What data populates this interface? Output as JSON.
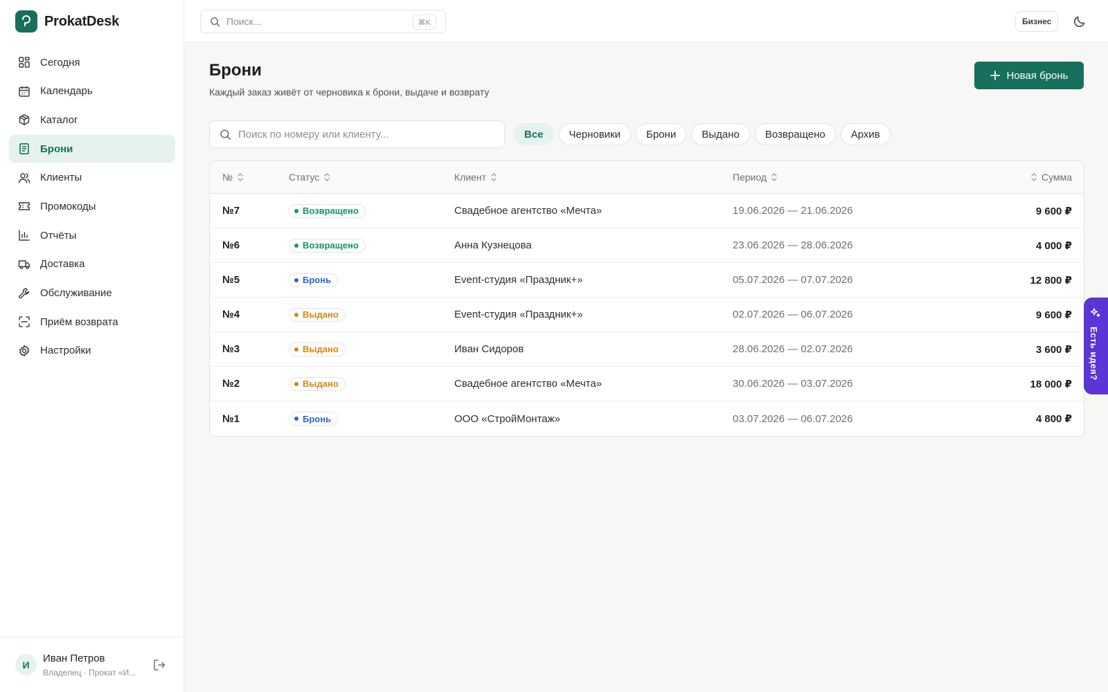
{
  "app": {
    "name": "ProkatDesk"
  },
  "sidebar": {
    "items": [
      {
        "label": "Сегодня",
        "icon": "dashboard-icon"
      },
      {
        "label": "Календарь",
        "icon": "calendar-icon"
      },
      {
        "label": "Каталог",
        "icon": "package-icon"
      },
      {
        "label": "Брони",
        "icon": "document-icon",
        "active": true
      },
      {
        "label": "Клиенты",
        "icon": "users-icon"
      },
      {
        "label": "Промокоды",
        "icon": "ticket-icon"
      },
      {
        "label": "Отчёты",
        "icon": "chart-icon"
      },
      {
        "label": "Доставка",
        "icon": "truck-icon"
      },
      {
        "label": "Обслуживание",
        "icon": "wrench-icon"
      },
      {
        "label": "Приём возврата",
        "icon": "scan-icon"
      },
      {
        "label": "Настройки",
        "icon": "gear-icon"
      }
    ]
  },
  "user": {
    "initial": "И",
    "name": "Иван Петров",
    "role": "Владелец · Прокат «И..."
  },
  "topbar": {
    "search_placeholder": "Поиск...",
    "shortcut": "⌘K",
    "plan": "Бизнес"
  },
  "page": {
    "title": "Брони",
    "subtitle": "Каждый заказ живёт от черновика к брони, выдаче и возврату",
    "new_button": "Новая бронь",
    "search_placeholder": "Поиск по номеру или клиенту...",
    "filters": [
      "Все",
      "Черновики",
      "Брони",
      "Выдано",
      "Возвращено",
      "Архив"
    ],
    "active_filter": "Все"
  },
  "table": {
    "columns": {
      "num": "№",
      "status": "Статус",
      "client": "Клиент",
      "period": "Период",
      "sum": "Сумма"
    },
    "rows": [
      {
        "num": "№7",
        "status": "Возвращено",
        "client": "Свадебное агентство «Мечта»",
        "period": "19.06.2026 — 21.06.2026",
        "sum": "9 600 ₽"
      },
      {
        "num": "№6",
        "status": "Возвращено",
        "client": "Анна Кузнецова",
        "period": "23.06.2026 — 28.06.2026",
        "sum": "4 000 ₽"
      },
      {
        "num": "№5",
        "status": "Бронь",
        "client": "Event-студия «Праздник+»",
        "period": "05.07.2026 — 07.07.2026",
        "sum": "12 800 ₽"
      },
      {
        "num": "№4",
        "status": "Выдано",
        "client": "Event-студия «Праздник+»",
        "period": "02.07.2026 — 06.07.2026",
        "sum": "9 600 ₽"
      },
      {
        "num": "№3",
        "status": "Выдано",
        "client": "Иван Сидоров",
        "period": "28.06.2026 — 02.07.2026",
        "sum": "3 600 ₽"
      },
      {
        "num": "№2",
        "status": "Выдано",
        "client": "Свадебное агентство «Мечта»",
        "period": "30.06.2026 — 03.07.2026",
        "sum": "18 000 ₽"
      },
      {
        "num": "№1",
        "status": "Бронь",
        "client": "ООО «СтройМонтаж»",
        "period": "03.07.2026 — 06.07.2026",
        "sum": "4 800 ₽"
      }
    ]
  },
  "status_colors": {
    "Возвращено": "#12936b",
    "Бронь": "#2f63d6",
    "Выдано": "#d98512"
  },
  "colors": {
    "brand": "#17705d",
    "brand_soft": "#e6f2ee",
    "idea": "#5b35d5"
  },
  "feedback": {
    "label": "Есть идея?"
  }
}
